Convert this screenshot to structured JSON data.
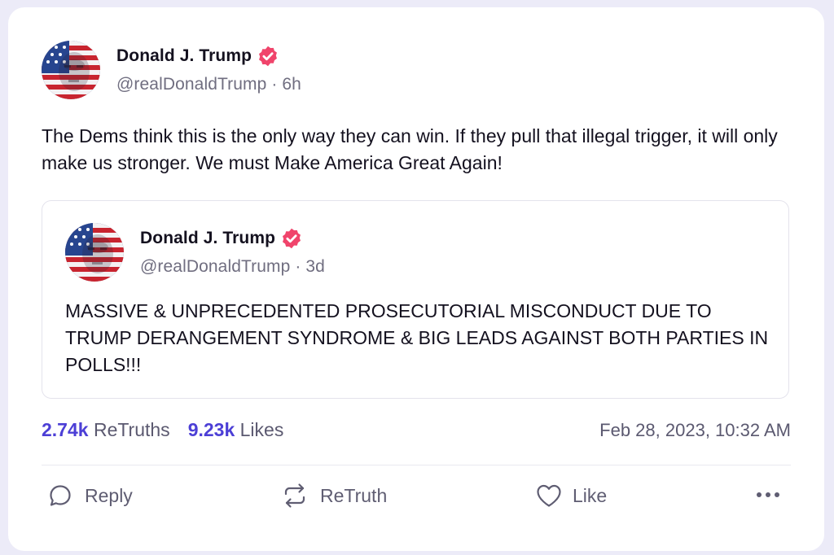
{
  "post": {
    "author": {
      "display_name": "Donald J. Trump",
      "handle": "@realDonaldTrump",
      "separator": "·",
      "time_ago": "6h",
      "avatar_icon": "american-flag-portrait-avatar",
      "verified_icon": "verified-badge-icon"
    },
    "text": "The Dems think this is the only way they can win. If they pull that illegal trigger, it will only make us stronger. We must Make America Great Again!"
  },
  "quoted_post": {
    "author": {
      "display_name": "Donald J. Trump",
      "handle": "@realDonaldTrump",
      "separator": "·",
      "time_ago": "3d",
      "avatar_icon": "american-flag-portrait-avatar",
      "verified_icon": "verified-badge-icon"
    },
    "text": "MASSIVE & UNPRECEDENTED PROSECUTORIAL MISCONDUCT DUE TO TRUMP DERANGEMENT SYNDROME & BIG LEADS AGAINST BOTH PARTIES IN POLLS!!!"
  },
  "stats": {
    "retruths_count": "2.74k",
    "retruths_label": "ReTruths",
    "likes_count": "9.23k",
    "likes_label": "Likes",
    "timestamp": "Feb 28, 2023, 10:32 AM"
  },
  "actions": [
    {
      "label": "Reply",
      "icon": "reply-bubble-icon"
    },
    {
      "label": "ReTruth",
      "icon": "retruth-arrows-icon"
    },
    {
      "label": "Like",
      "icon": "heart-icon"
    },
    {
      "label": "",
      "icon": "more-options-icon"
    }
  ],
  "colors": {
    "accent": "#4c3fd6",
    "verified_badge": "#f0446b",
    "page_background": "#ecebf8",
    "card_background": "#ffffff"
  }
}
